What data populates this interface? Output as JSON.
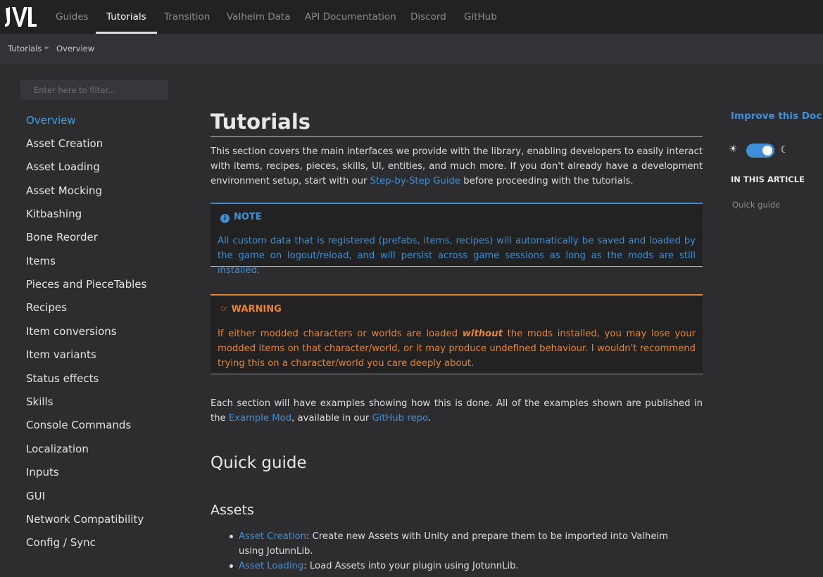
{
  "nav": {
    "items": [
      "Guides",
      "Tutorials",
      "Transition",
      "Valheim Data",
      "API Documentation",
      "Discord",
      "GitHub"
    ],
    "active": "Tutorials"
  },
  "breadcrumb": [
    "Tutorials",
    "Overview"
  ],
  "sidebar": {
    "filter_placeholder": "Enter here to filter...",
    "items": [
      "Overview",
      "Asset Creation",
      "Asset Loading",
      "Asset Mocking",
      "Kitbashing",
      "Bone Reorder",
      "Items",
      "Pieces and PieceTables",
      "Recipes",
      "Item conversions",
      "Item variants",
      "Status effects",
      "Skills",
      "Console Commands",
      "Localization",
      "Inputs",
      "GUI",
      "Network Compatibility",
      "Config / Sync"
    ],
    "active": "Overview"
  },
  "article": {
    "title": "Tutorials",
    "intro_text": "This section covers the main interfaces we provide with the library, enabling developers to easily interact with items, recipes, pieces, skills, UI, entities, and much more. If you don't already have a development environment setup, start with our ",
    "intro_link": "Step-by-Step Guide",
    "intro_after": " before proceeding with the tutorials.",
    "note": {
      "title": "NOTE",
      "body": "All custom data that is registered (prefabs, items, recipes) will automatically be saved and loaded by the game on logout/reload, and will persist across game sessions as long as the mods are still installed."
    },
    "warning": {
      "title": "WARNING",
      "body_before": "If either modded characters or worlds are loaded ",
      "body_emphasis": "without",
      "body_after": " the mods installed, you may lose your modded items on that character/world, or it may produce undefined behaviour. I wouldn't recommend trying this on a character/world you care deeply about."
    },
    "examples_text": "Each section will have examples showing how this is done. All of the examples shown are published in the ",
    "examples_link": "Example Mod",
    "examples_mid": ", available in our ",
    "examples_link2": "GitHub repo",
    "examples_end": ".",
    "quick_guide_heading": "Quick guide",
    "assets_heading": "Assets",
    "bullets": [
      {
        "link": "Asset Creation",
        "text": ": Create new Assets with Unity and prepare them to be imported into Valheim using JotunnLib."
      },
      {
        "link": "Asset Loading",
        "text": ": Load Assets into your plugin using JotunnLib."
      }
    ]
  },
  "aside": {
    "improve": "Improve this Doc",
    "in_this_article": "IN THIS ARTICLE",
    "links": [
      "Quick guide"
    ],
    "theme_dark": true
  },
  "colors": {
    "accent": "#3f8fd6",
    "warning": "#e98433",
    "background": "#2d2d30"
  }
}
